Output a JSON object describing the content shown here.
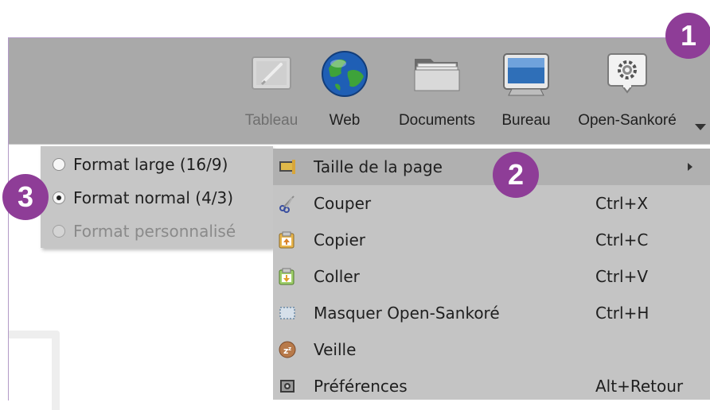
{
  "toolbar": {
    "buttons": [
      {
        "label": "Tableau",
        "icon": "whiteboard-icon",
        "disabled": true
      },
      {
        "label": "Web",
        "icon": "globe-icon",
        "disabled": false
      },
      {
        "label": "Documents",
        "icon": "folder-icon",
        "disabled": false
      },
      {
        "label": "Bureau",
        "icon": "monitor-icon",
        "disabled": false
      },
      {
        "label": "Open-Sankoré",
        "icon": "gear-icon",
        "disabled": false
      }
    ],
    "more_icon": "chevron-down-icon"
  },
  "page_size_submenu": {
    "options": [
      {
        "label": "Format large (16/9)",
        "checked": false,
        "disabled": false
      },
      {
        "label": "Format normal (4/3)",
        "checked": true,
        "disabled": false
      },
      {
        "label": "Format personnalisé",
        "checked": false,
        "disabled": true
      }
    ]
  },
  "context_menu": {
    "items": [
      {
        "label": "Taille de la page",
        "shortcut": "",
        "icon": "page-size-icon",
        "has_submenu": true,
        "highlighted": true
      },
      {
        "label": "Couper",
        "shortcut": "Ctrl+X",
        "icon": "scissors-icon",
        "has_submenu": false,
        "highlighted": false
      },
      {
        "label": "Copier",
        "shortcut": "Ctrl+C",
        "icon": "copy-icon",
        "has_submenu": false,
        "highlighted": false
      },
      {
        "label": "Coller",
        "shortcut": "Ctrl+V",
        "icon": "paste-icon",
        "has_submenu": false,
        "highlighted": false
      },
      {
        "label": "Masquer Open-Sankoré",
        "shortcut": "Ctrl+H",
        "icon": "hide-icon",
        "has_submenu": false,
        "highlighted": false
      },
      {
        "label": "Veille",
        "shortcut": "",
        "icon": "sleep-icon",
        "has_submenu": false,
        "highlighted": false
      },
      {
        "label": "Préférences",
        "shortcut": "Alt+Retour",
        "icon": "preferences-icon",
        "has_submenu": false,
        "highlighted": false
      }
    ]
  },
  "callouts": [
    "1",
    "2",
    "3"
  ],
  "colors": {
    "callout": "#8e3d97",
    "toolbar_bg": "#a9a9a9",
    "menu_bg": "#c4c4c4",
    "highlight_bg": "#b0b0b0"
  }
}
